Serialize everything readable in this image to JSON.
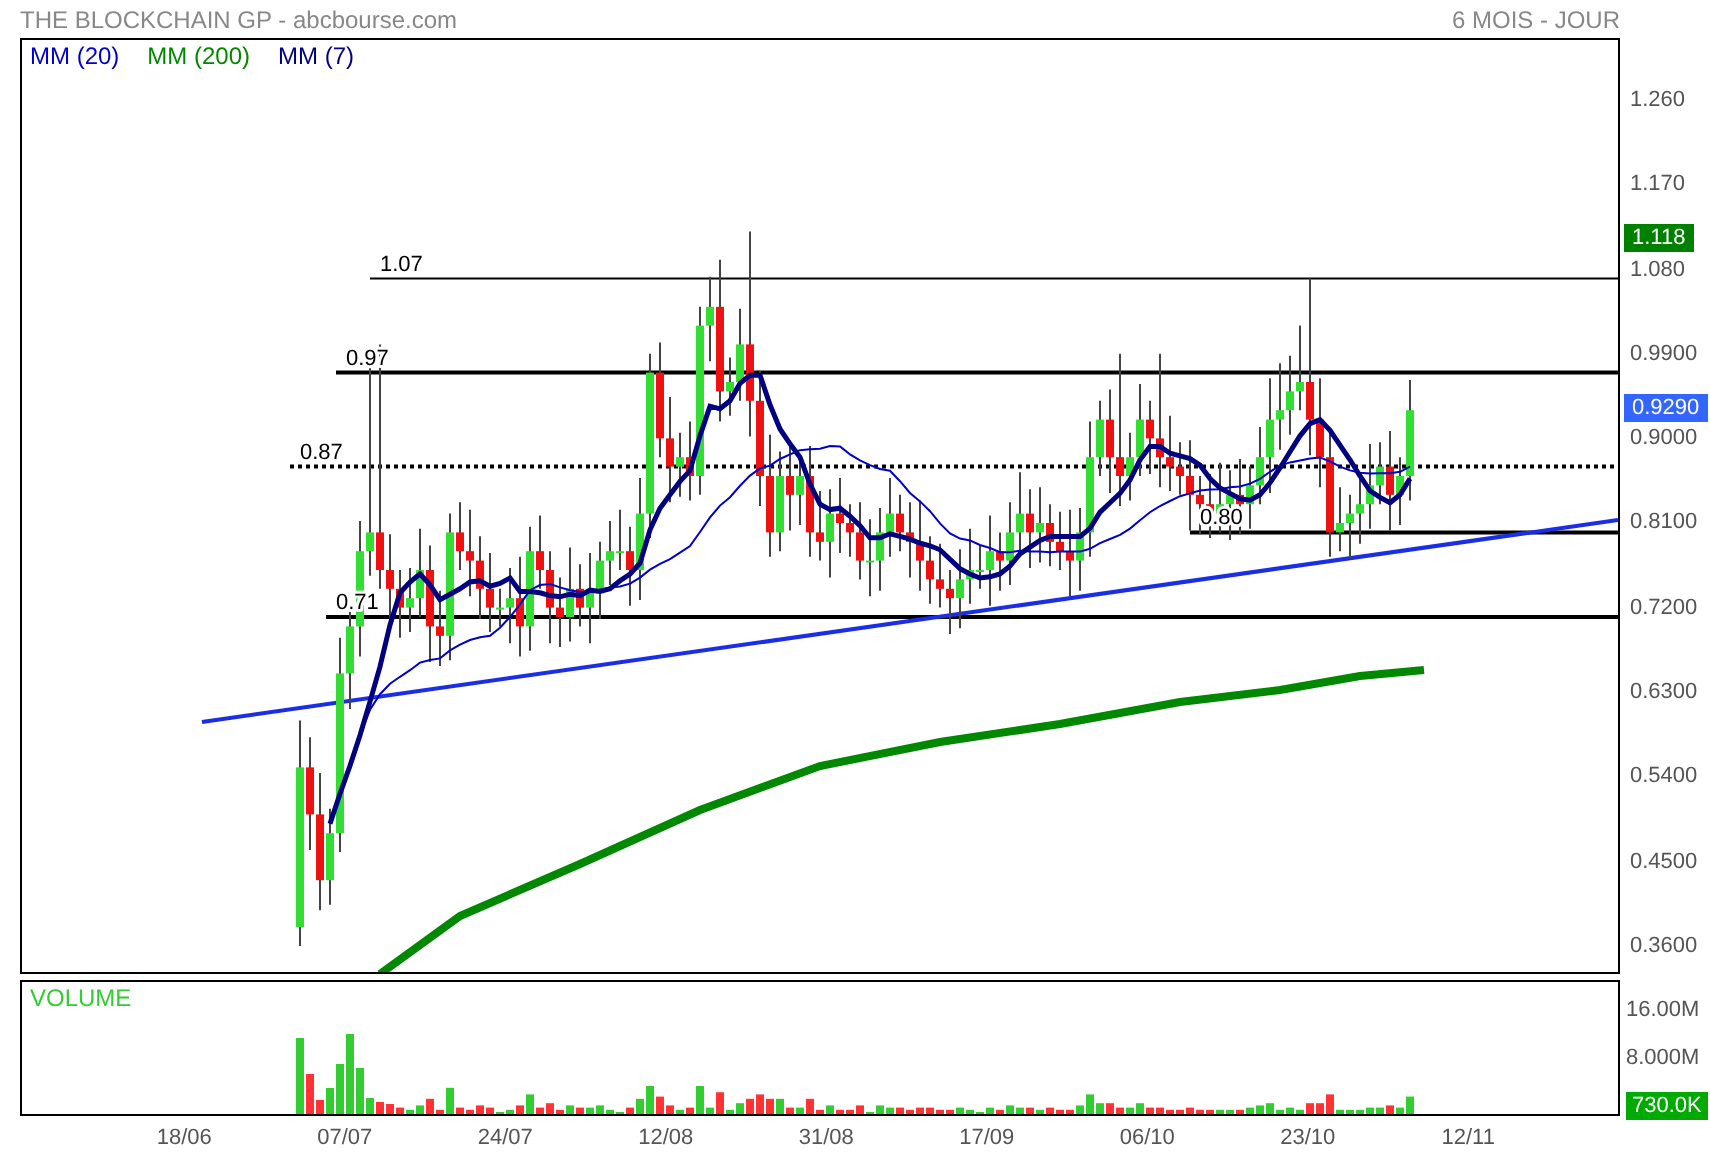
{
  "header": {
    "title": "THE BLOCKCHAIN GP - abcbourse.com",
    "period": "6 MOIS - JOUR"
  },
  "price_chart": {
    "legend": [
      {
        "label": "MM (20)",
        "color": "#0000cc"
      },
      {
        "label": "MM (200)",
        "color": "#008800"
      },
      {
        "label": "MM (7)",
        "color": "#000080"
      }
    ],
    "levels": [
      {
        "label": "1.07"
      },
      {
        "label": "0.97"
      },
      {
        "label": "0.87"
      },
      {
        "label": "0.80"
      },
      {
        "label": "0.71"
      }
    ],
    "y_axis": [
      "1.260",
      "1.170",
      "1.080",
      "0.9900",
      "0.9000",
      "0.8100",
      "0.7200",
      "0.6300",
      "0.5400",
      "0.4500",
      "0.3600"
    ],
    "badges": [
      {
        "kind": "high",
        "label": "1.118"
      },
      {
        "kind": "last",
        "label": "0.9290"
      }
    ]
  },
  "volume_chart": {
    "title": "VOLUME",
    "y_axis": [
      "16.00M",
      "8.000M"
    ],
    "badge": "730.0K"
  },
  "x_axis": [
    "18/06",
    "07/07",
    "24/07",
    "12/08",
    "31/08",
    "17/09",
    "06/10",
    "23/10",
    "12/11"
  ]
}
